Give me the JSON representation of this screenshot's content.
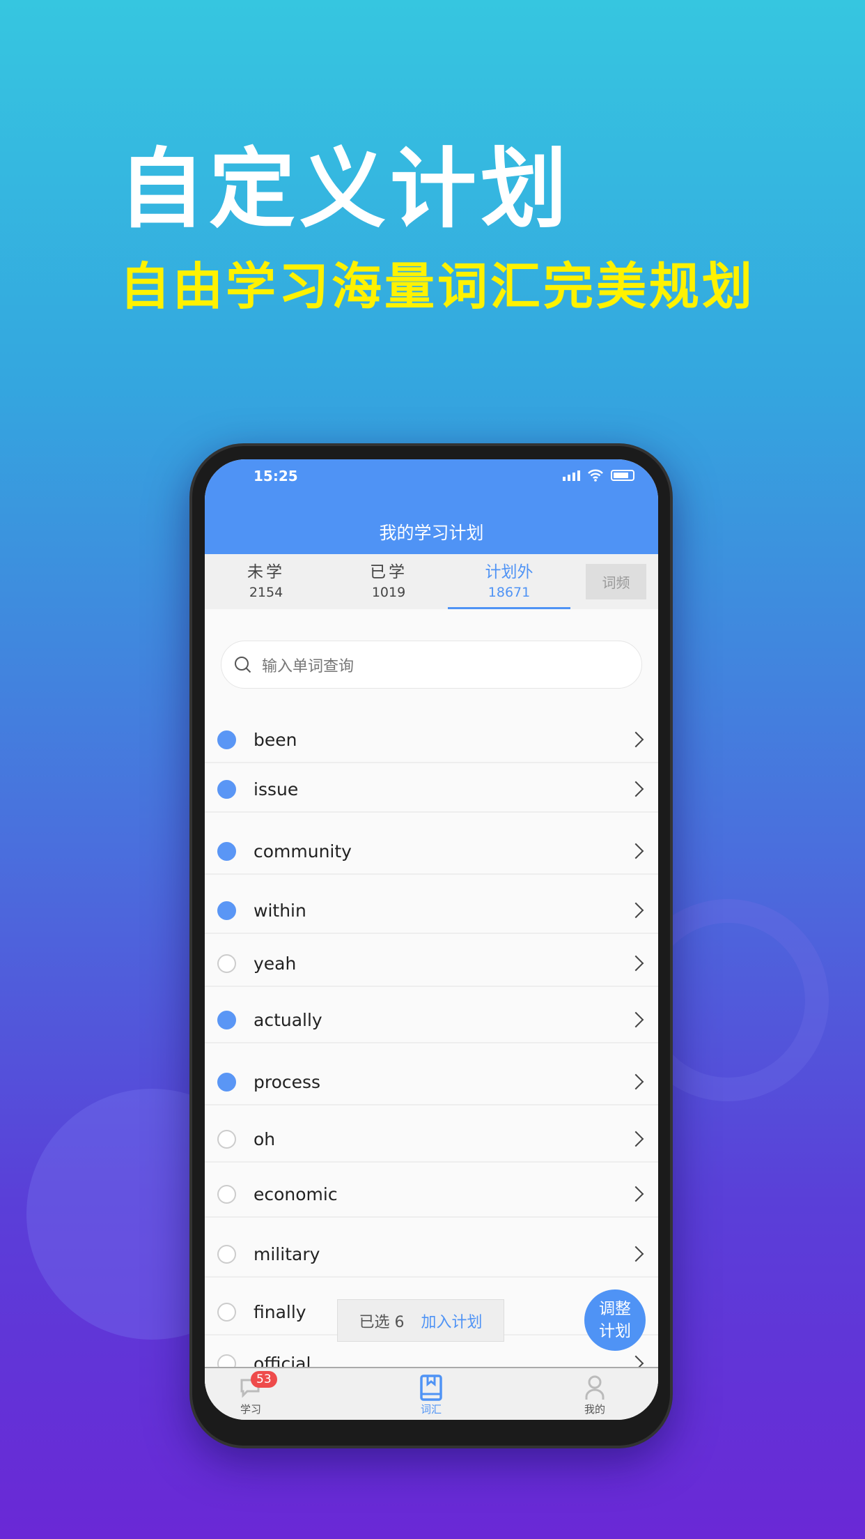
{
  "hero": {
    "title": "自定义计划",
    "subtitle": "自由学习海量词汇完美规划"
  },
  "status": {
    "time": "15:25"
  },
  "header": {
    "title": "我的学习计划"
  },
  "tabs": [
    {
      "label": "未学",
      "count": "2154"
    },
    {
      "label": "已学",
      "count": "1019"
    },
    {
      "label": "计划外",
      "count": "18671",
      "active": true
    }
  ],
  "freq_button": "词频",
  "search": {
    "placeholder": "输入单词查询"
  },
  "words": [
    {
      "word": "been",
      "selected": true
    },
    {
      "word": "issue",
      "selected": true
    },
    {
      "word": "community",
      "selected": true
    },
    {
      "word": "within",
      "selected": true
    },
    {
      "word": "yeah",
      "selected": false
    },
    {
      "word": "actually",
      "selected": true
    },
    {
      "word": "process",
      "selected": true
    },
    {
      "word": "oh",
      "selected": false
    },
    {
      "word": "economic",
      "selected": false
    },
    {
      "word": "military",
      "selected": false
    },
    {
      "word": "finally",
      "selected": false
    },
    {
      "word": "official",
      "selected": false
    }
  ],
  "selection": {
    "label": "已选 6",
    "action": "加入计划"
  },
  "fab": {
    "line1": "调整",
    "line2": "计划"
  },
  "tabbar": [
    {
      "label": "学习",
      "badge": "53"
    },
    {
      "label": "词汇",
      "active": true
    },
    {
      "label": "我的"
    }
  ],
  "colors": {
    "accent": "#4f93f5",
    "subtitle": "#fff200",
    "badge": "#ee4b4b"
  }
}
